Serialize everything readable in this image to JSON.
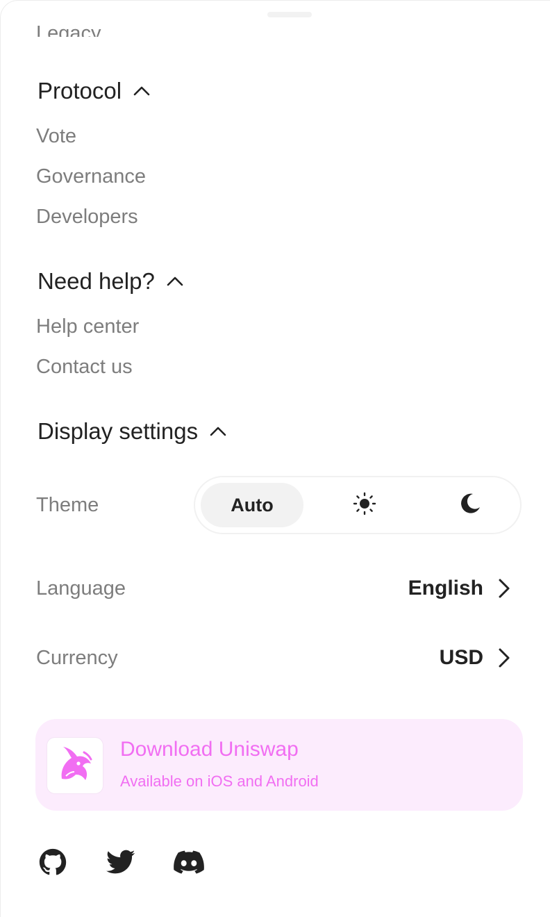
{
  "clipped_item": "Legacy",
  "protocol": {
    "title": "Protocol",
    "items": [
      "Vote",
      "Governance",
      "Developers"
    ]
  },
  "help": {
    "title": "Need help?",
    "items": [
      "Help center",
      "Contact us"
    ]
  },
  "display": {
    "title": "Display settings",
    "theme": {
      "label": "Theme",
      "options": [
        {
          "label": "Auto",
          "icon": "auto",
          "selected": true
        },
        {
          "label": "",
          "icon": "sun-icon",
          "selected": false
        },
        {
          "label": "",
          "icon": "moon-icon",
          "selected": false
        }
      ]
    },
    "language": {
      "label": "Language",
      "value": "English"
    },
    "currency": {
      "label": "Currency",
      "value": "USD"
    }
  },
  "download": {
    "title": "Download Uniswap",
    "subtitle": "Available on iOS and Android",
    "accent": "#F16EF2",
    "background": "#FCECFD"
  },
  "social": [
    "github-icon",
    "twitter-icon",
    "discord-icon"
  ],
  "colors": {
    "heading": "#222222",
    "muted": "#7D7D7D",
    "toggle_active": "#F2F2F2"
  }
}
